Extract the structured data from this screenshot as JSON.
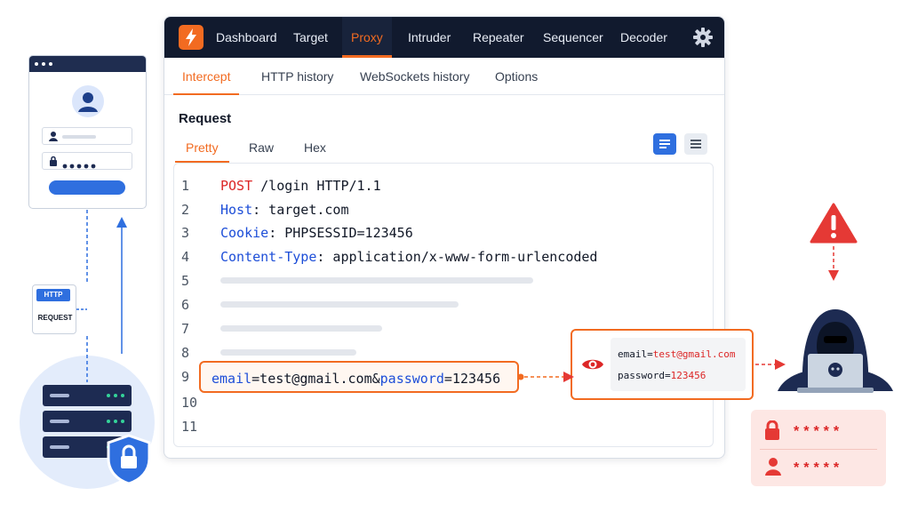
{
  "nav": {
    "items": [
      "Dashboard",
      "Target",
      "Proxy",
      "Intruder",
      "Repeater",
      "Sequencer",
      "Decoder"
    ],
    "active": "Proxy"
  },
  "subtabs": {
    "items": [
      "Intercept",
      "HTTP history",
      "WebSockets history",
      "Options"
    ],
    "active": "Intercept"
  },
  "request": {
    "title": "Request",
    "view_tabs": [
      "Pretty",
      "Raw",
      "Hex"
    ],
    "active_view": "Pretty",
    "line_numbers": [
      "1",
      "2",
      "3",
      "4",
      "5",
      "6",
      "7",
      "8",
      "9",
      "10",
      "11"
    ],
    "lines": {
      "l1_method": "POST",
      "l1_rest": " /login HTTP/1.1",
      "l2_key": "Host",
      "l2_val": ": target.com",
      "l3_key": "Cookie",
      "l3_val": ": PHPSESSID=123456",
      "l4_key": "Content-Type",
      "l4_val": ": application/x-www-form-urlencoded",
      "l9_email_key": "email",
      "l9_email_val": "=test@gmail.com&",
      "l9_pw_key": "password",
      "l9_pw_val": "=123456"
    }
  },
  "http_doc": {
    "tag": "HTTP",
    "label": "REQUEST"
  },
  "leak": {
    "email_key": "email=",
    "email_val": "test@gmail.com",
    "pw_key": "password=",
    "pw_val": "123456"
  },
  "credentials": {
    "masked_password": "*****",
    "masked_user": "*****"
  },
  "colors": {
    "accent": "#f26b21",
    "nav_bg": "#111a2e",
    "blue": "#2f6fdf",
    "danger": "#dc2626",
    "navy": "#1d2b52"
  }
}
